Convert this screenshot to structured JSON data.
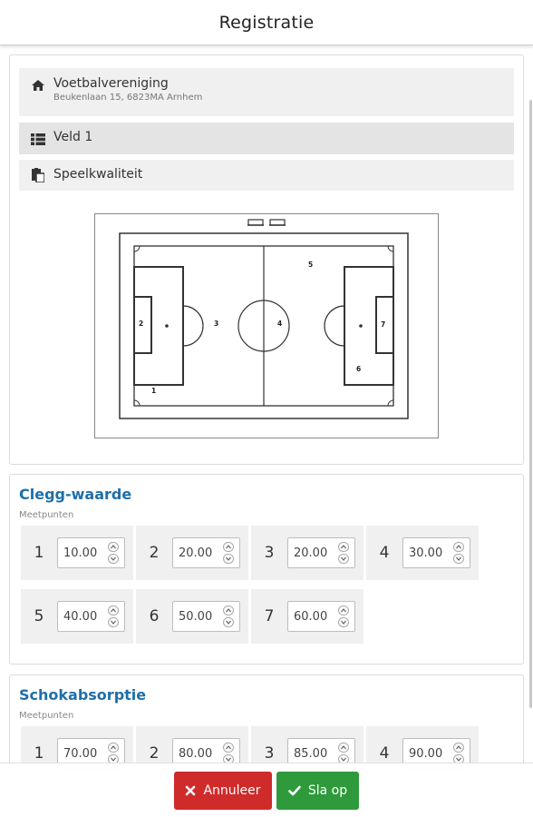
{
  "header": {
    "title": "Registratie"
  },
  "venue": {
    "club_name": "Voetbalvereniging",
    "address": "Beukenlaan 15, 6823MA Arnhem",
    "field": "Veld 1",
    "category": "Speelkwaliteit"
  },
  "pitch": {
    "zones": [
      "1",
      "2",
      "3",
      "4",
      "5",
      "6",
      "7"
    ]
  },
  "clegg": {
    "title": "Clegg-waarde",
    "subtitle": "Meetpunten",
    "points": [
      {
        "label": "1",
        "value": "10.00"
      },
      {
        "label": "2",
        "value": "20.00"
      },
      {
        "label": "3",
        "value": "20.00"
      },
      {
        "label": "4",
        "value": "30.00"
      },
      {
        "label": "5",
        "value": "40.00"
      },
      {
        "label": "6",
        "value": "50.00"
      },
      {
        "label": "7",
        "value": "60.00"
      }
    ]
  },
  "shock": {
    "title": "Schokabsorptie",
    "subtitle": "Meetpunten",
    "points": [
      {
        "label": "1",
        "value": "70.00"
      },
      {
        "label": "2",
        "value": "80.00"
      },
      {
        "label": "3",
        "value": "85.00"
      },
      {
        "label": "4",
        "value": "90.00"
      }
    ]
  },
  "footer": {
    "cancel_label": "Annuleer",
    "save_label": "Sla op"
  },
  "colors": {
    "accent": "#1f6fa8",
    "cancel": "#cf2b2b",
    "save": "#2e9a3b"
  },
  "icons": {
    "club": "home-icon",
    "field": "grid-icon",
    "category": "clipboard-icon",
    "cancel": "close-icon",
    "save": "check-icon"
  }
}
